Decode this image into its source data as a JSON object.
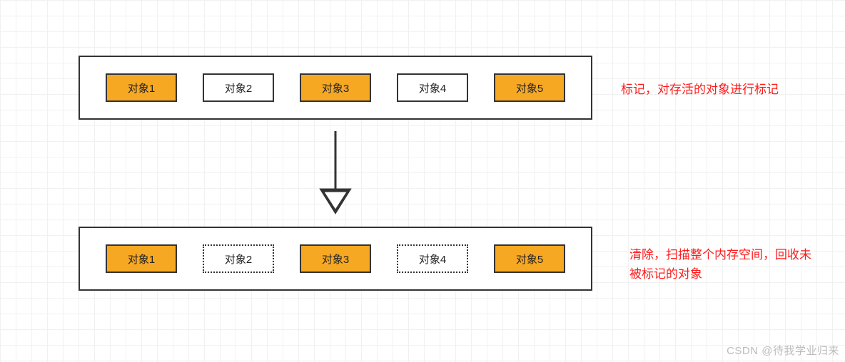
{
  "rows": {
    "top": {
      "objects": [
        {
          "label": "对象1",
          "state": "marked"
        },
        {
          "label": "对象2",
          "state": "unmarked-solid"
        },
        {
          "label": "对象3",
          "state": "marked"
        },
        {
          "label": "对象4",
          "state": "unmarked-solid"
        },
        {
          "label": "对象5",
          "state": "marked"
        }
      ]
    },
    "bottom": {
      "objects": [
        {
          "label": "对象1",
          "state": "marked"
        },
        {
          "label": "对象2",
          "state": "unmarked-dashed"
        },
        {
          "label": "对象3",
          "state": "marked"
        },
        {
          "label": "对象4",
          "state": "unmarked-dashed"
        },
        {
          "label": "对象5",
          "state": "marked"
        }
      ]
    }
  },
  "captions": {
    "top": "标记，对存活的对象进行标记",
    "bottom": "清除，扫描整个内存空间，回收未被标记的对象"
  },
  "watermark": "CSDN @待我学业归来",
  "colors": {
    "marked_fill": "#f7a823",
    "border": "#333333",
    "caption": "#ff1a1a"
  }
}
